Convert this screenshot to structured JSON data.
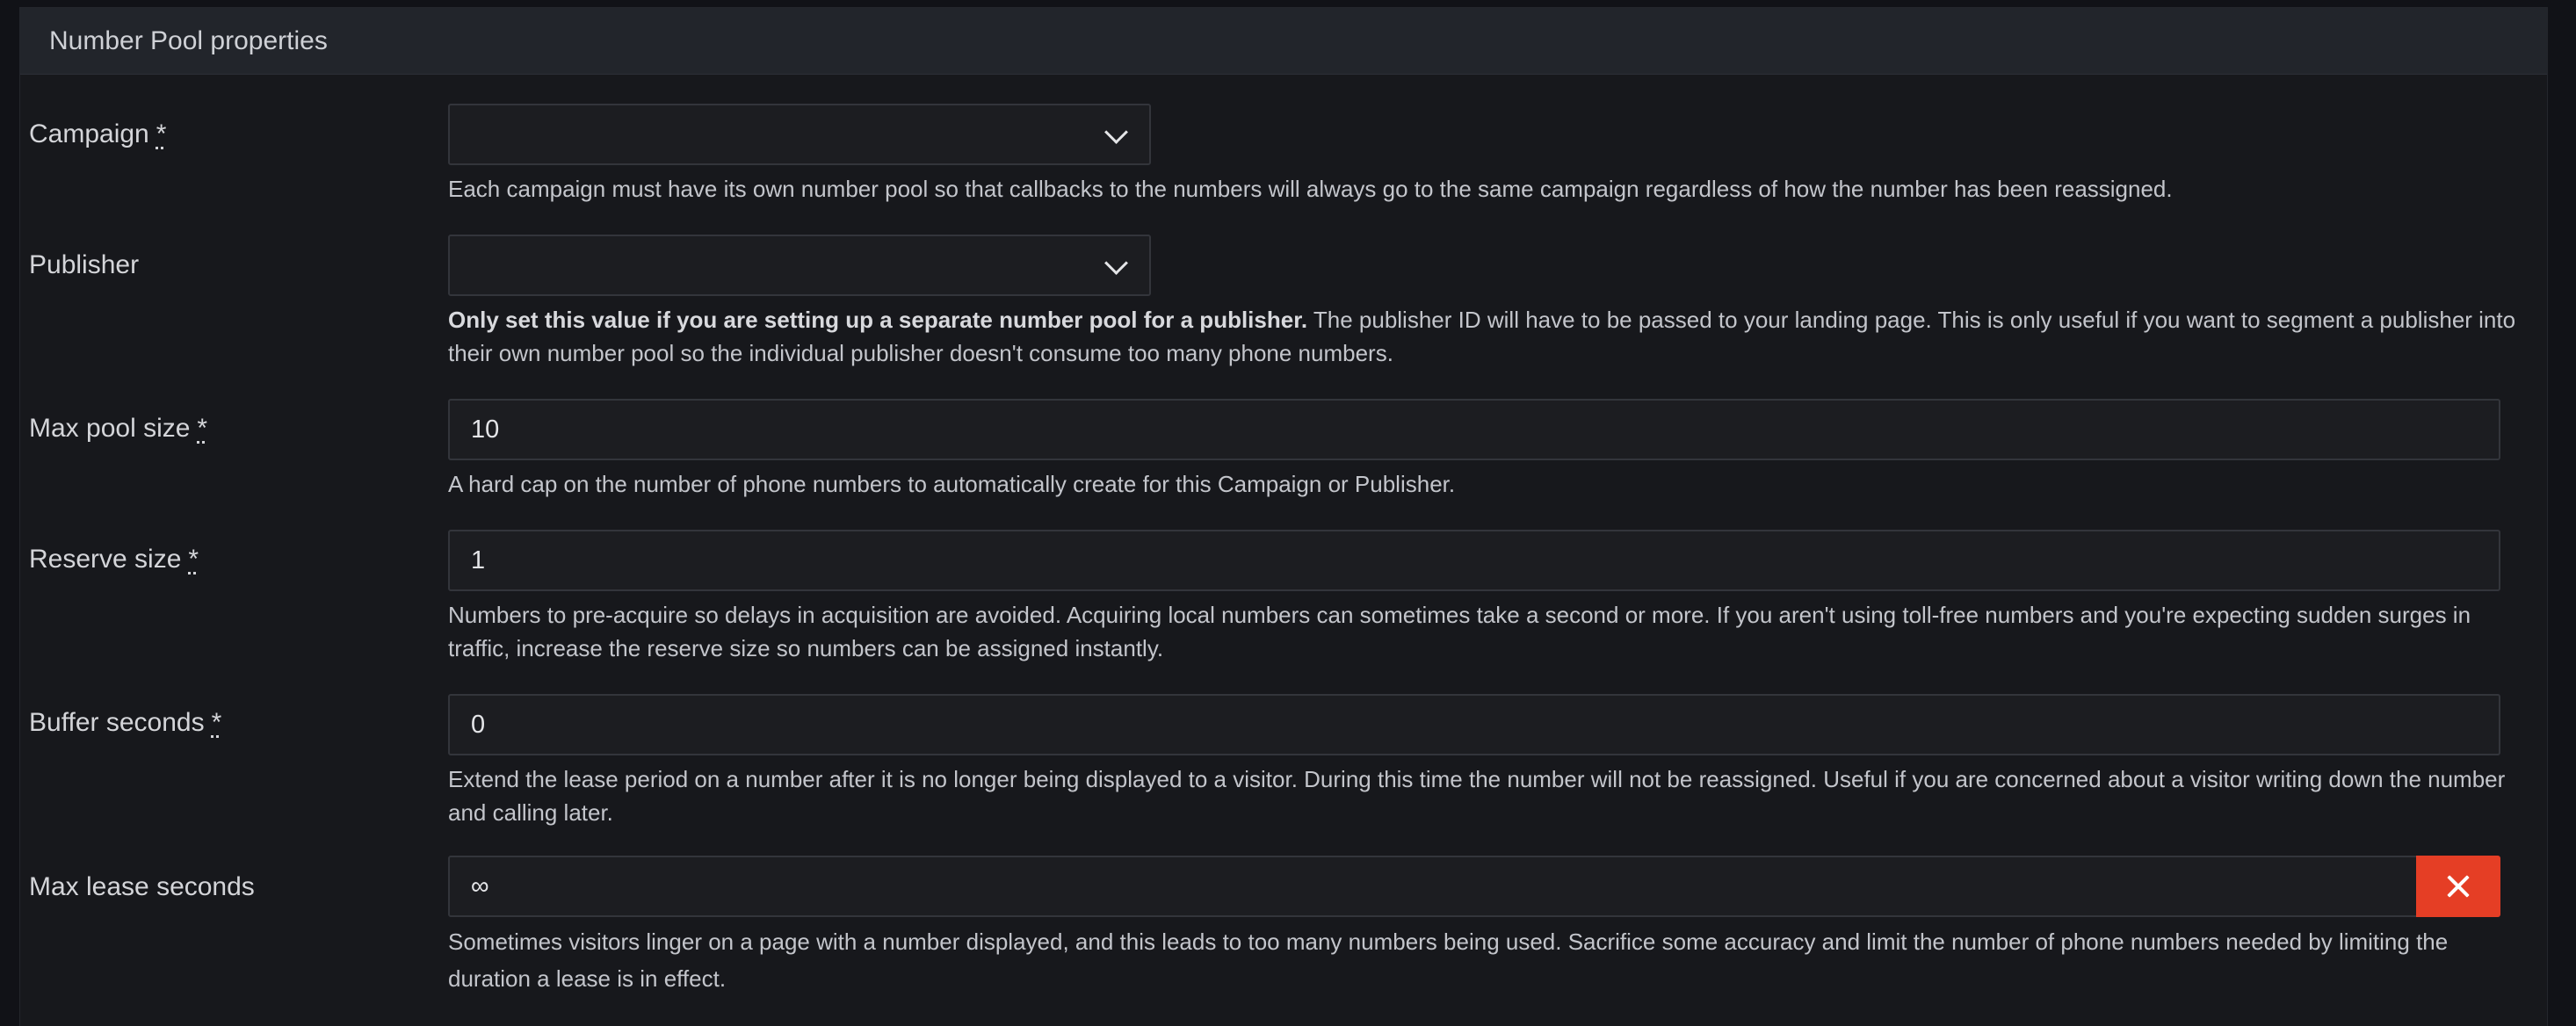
{
  "panel": {
    "title": "Number Pool properties"
  },
  "required_marker": "*",
  "fields": {
    "campaign": {
      "label": "Campaign",
      "value": "",
      "help": "Each campaign must have its own number pool so that callbacks to the numbers will always go to the same campaign regardless of how the number has been reassigned."
    },
    "publisher": {
      "label": "Publisher",
      "value": "",
      "help_bold": "Only set this value if you are setting up a separate number pool for a publisher.",
      "help": " The publisher ID will have to be passed to your landing page. This is only useful if you want to segment a publisher into their own number pool so the individual publisher doesn't consume too many phone numbers."
    },
    "max_pool_size": {
      "label": "Max pool size",
      "value": "10",
      "help": "A hard cap on the number of phone numbers to automatically create for this Campaign or Publisher."
    },
    "reserve_size": {
      "label": "Reserve size",
      "value": "1",
      "help": "Numbers to pre-acquire so delays in acquisition are avoided. Acquiring local numbers can sometimes take a second or more. If you aren't using toll-free numbers and you're expecting sudden surges in traffic, increase the reserve size so numbers can be assigned instantly."
    },
    "buffer_seconds": {
      "label": "Buffer seconds",
      "value": "0",
      "help": "Extend the lease period on a number after it is no longer being displayed to a visitor. During this time the number will not be reassigned. Useful if you are concerned about a visitor writing down the number and calling later."
    },
    "max_lease_seconds": {
      "label": "Max lease seconds",
      "value": "∞",
      "help": "Sometimes visitors linger on a page with a number displayed, and this leads to too many numbers being used. Sacrifice some accuracy and limit the number of phone numbers needed by limiting the duration a lease is in effect."
    }
  },
  "icons": {
    "select_chevron": "chevron-down-icon",
    "clear": "close-icon"
  },
  "colors": {
    "background": "#111217",
    "panel": "#17181c",
    "header": "#22252b",
    "danger": "#e53e25"
  }
}
